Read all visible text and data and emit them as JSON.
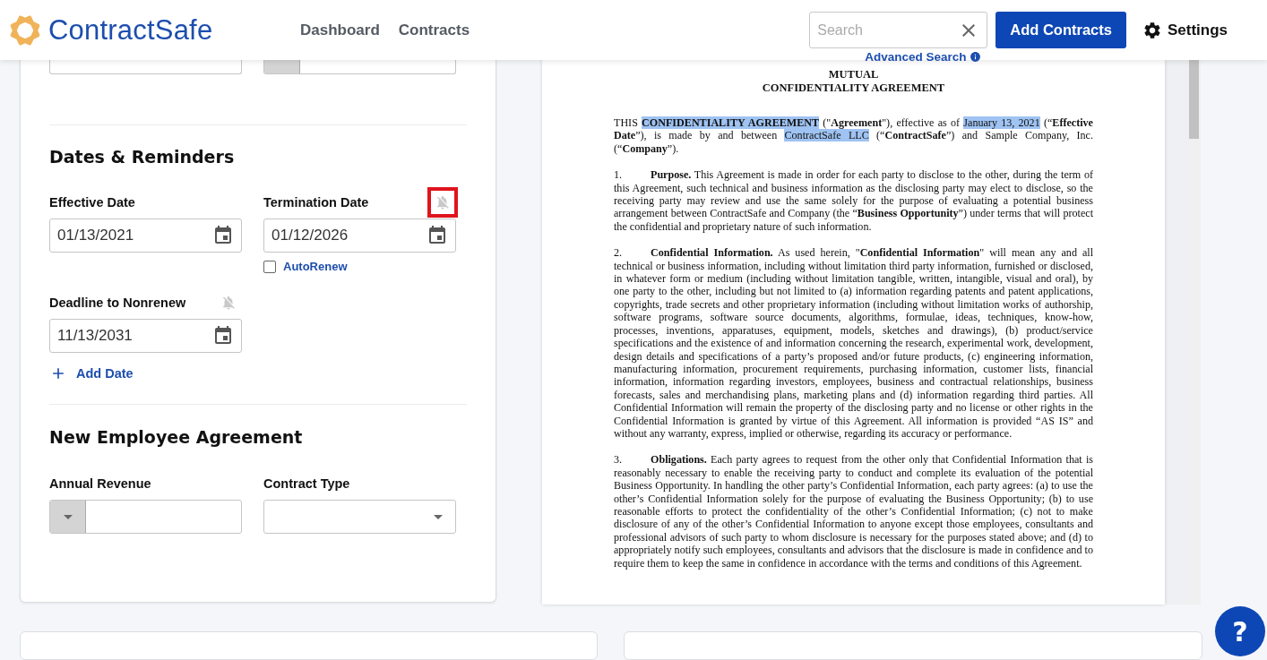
{
  "header": {
    "logo": "ContractSafe",
    "nav": [
      {
        "label": "Dashboard"
      },
      {
        "label": "Contracts"
      }
    ],
    "search": {
      "placeholder": "Search"
    },
    "advanced_search": "Advanced Search",
    "add_button": "Add Contracts",
    "settings": "Settings"
  },
  "form": {
    "top_fields": [
      {
        "kind": "select"
      },
      {
        "kind": "currency"
      }
    ],
    "sections": [
      {
        "title": "Dates & Reminders",
        "fields": [
          {
            "kind": "date",
            "label": "Effective Date",
            "value": "01/13/2021"
          },
          {
            "kind": "date",
            "label": "Termination Date",
            "value": "01/12/2026",
            "reminder": true,
            "annotated": true,
            "checkbox": {
              "label": "AutoRenew",
              "checked": false
            }
          },
          {
            "kind": "date",
            "label": "Deadline to Nonrenew",
            "value": "11/13/2031",
            "reminder": true,
            "annotated": false
          }
        ],
        "add_link": "Add Date"
      },
      {
        "title": "New Employee Agreement",
        "fields": [
          {
            "kind": "currency",
            "label": "Annual Revenue"
          },
          {
            "kind": "select",
            "label": "Contract Type"
          }
        ]
      }
    ]
  },
  "document": {
    "title_lines": [
      "MUTUAL",
      "CONFIDENTIALITY AGREEMENT"
    ],
    "paragraphs": [
      {
        "segments": [
          {
            "text": "THIS "
          },
          {
            "text": "CONFIDENTIALITY AGREEMENT",
            "bold": true,
            "highlighted": true
          },
          {
            "text": " (\""
          },
          {
            "text": "Agreement",
            "bold": true
          },
          {
            "text": "\"), effective as of "
          },
          {
            "text": "January 13, 2021",
            "highlighted": true
          },
          {
            "text": " (“"
          },
          {
            "text": "Effective Date",
            "bold": true
          },
          {
            "text": "”), is made by and between "
          },
          {
            "text": "ContractSafe LLC",
            "highlighted": true
          },
          {
            "text": " (“"
          },
          {
            "text": "ContractSafe",
            "bold": true
          },
          {
            "text": "”) and Sample Company, Inc. (“"
          },
          {
            "text": "Company",
            "bold": true
          },
          {
            "text": "”)."
          }
        ]
      },
      {
        "number": "1.",
        "segments": [
          {
            "text": "Purpose.",
            "bold": true
          },
          {
            "text": "  This Agreement is made in order for each party to disclose to the other, during the term of this Agreement, such technical and business information as the disclosing party may elect to disclose, so the receiving party may review and use the same solely for the purpose of evaluating a potential business arrangement between ContractSafe and Company (the “"
          },
          {
            "text": "Business Opportunity",
            "bold": true
          },
          {
            "text": "”) under terms that will protect the confidential and proprietary nature of such information."
          }
        ]
      },
      {
        "number": "2.",
        "segments": [
          {
            "text": "Confidential Information.",
            "bold": true
          },
          {
            "text": "  As used herein, \""
          },
          {
            "text": "Confidential Information",
            "bold": true
          },
          {
            "text": "\" will mean any and all technical or business information, including without limitation third party information, furnished or disclosed, in whatever form or medium (including without limitation tangible, written, intangible, visual and oral), by one party to the other, including but not limited to (a) information regarding patents and patent applications, copyrights, trade secrets and other proprietary information (including without limitation works of authorship, software programs, software source documents, algorithms, formulae, ideas, techniques, know-how, processes, inventions, apparatuses, equipment, models, sketches and drawings), (b) product/service specifications and the existence of and information concerning the research, experimental work, development, design details and specifications of a party’s proposed and/or future products, (c) engineering information, manufacturing information, procurement requirements, purchasing information, customer lists, financial information, information regarding investors, employees, business and contractual relationships, business forecasts, sales and merchandising plans, marketing plans and (d) information regarding third parties.  All Confidential Information will remain the property of the disclosing party and no license or other rights in the Confidential Information is granted by virtue of this Agreement.  All information is provided “AS IS” and without any warranty, express, implied or otherwise, regarding its accuracy or performance."
          }
        ]
      },
      {
        "number": "3.",
        "segments": [
          {
            "text": "Obligations.",
            "bold": true
          },
          {
            "text": "  Each party agrees to request from the other only that Confidential Information that is reasonably necessary to enable the receiving party to conduct and complete its evaluation of the potential Business Opportunity.  In handling the other party’s Confidential Information, each party agrees:  (a) to use the other’s Confidential Information solely for the purpose of evaluating the Business Opportunity; (b) to use reasonable efforts to protect the confidentiality of the other’s Confidential Information; (c) not to make disclosure of any of the other’s Confidential Information to anyone except those employees, consultants and professional advisors of such party to whom disclosure is necessary for the purposes stated above; and (d) to appropriately notify such employees, consultants and advisors that the disclosure is made in confidence and to require them to keep the same in confidence in accordance with the terms and conditions of this Agreement."
          }
        ]
      }
    ]
  },
  "help_button": "?"
}
